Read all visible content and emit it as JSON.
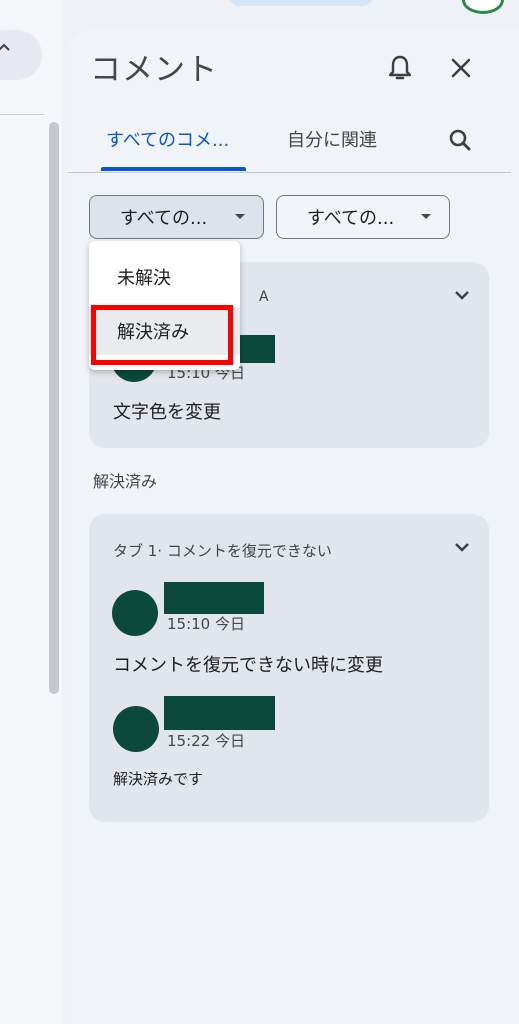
{
  "panel": {
    "title": "コメント"
  },
  "tabs": [
    {
      "label": "すべてのコメ..."
    },
    {
      "label": "自分に関連"
    }
  ],
  "filters": {
    "status_value": "すべての...",
    "type_value": "すべての..."
  },
  "menu": {
    "items": [
      {
        "label": "未解決"
      },
      {
        "label": "解決済み"
      }
    ]
  },
  "cards": [
    {
      "partial_header": "A",
      "timestamp": "15:10 今日",
      "text": "文字色を変更"
    },
    {
      "quote": "タブ 1· コメントを復元できない",
      "comment": {
        "timestamp": "15:10 今日",
        "text": "コメントを復元できない時に変更"
      },
      "reply": {
        "timestamp": "15:22 今日",
        "text": "解決済みです"
      }
    }
  ],
  "section": {
    "resolved_label": "解決済み"
  },
  "colors": {
    "accent": "#0b57d0",
    "avatar": "#0b4a3a",
    "highlight": "#ff0000"
  }
}
